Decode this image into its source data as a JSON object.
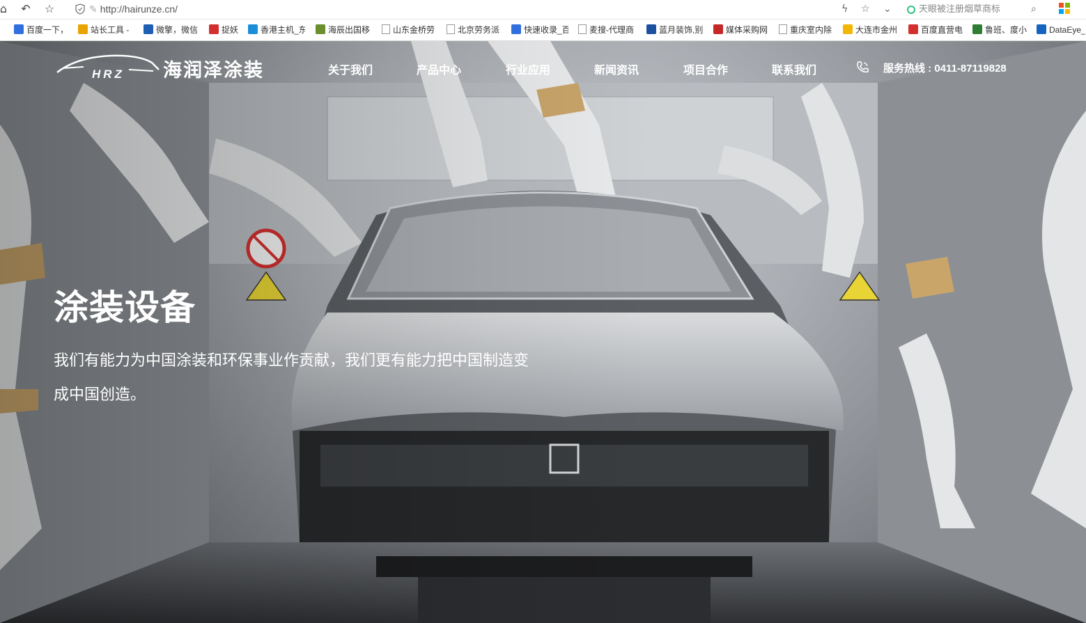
{
  "browser": {
    "url": "http://hairunze.cn/",
    "search_suggestion": "天眼被注册烟草商标",
    "bookmarks": [
      {
        "label": "百度一下，",
        "icon": "paw-icon",
        "color": "#2f6fde"
      },
      {
        "label": "站长工具 -",
        "icon": "chart-icon",
        "color": "#e8a400"
      },
      {
        "label": "微擎，微信",
        "icon": "m-icon",
        "color": "#1e5fb3"
      },
      {
        "label": "捉妖",
        "icon": "red-badge-icon",
        "color": "#d32f2f"
      },
      {
        "label": "香港主机_东",
        "icon": "ie-icon",
        "color": "#1a8fd8"
      },
      {
        "label": "海辰出国移",
        "icon": "grid-icon",
        "color": "#6a8f2d"
      },
      {
        "label": "山东金桥劳",
        "icon": "page-icon",
        "color": "#999999"
      },
      {
        "label": "北京劳务派",
        "icon": "page-icon",
        "color": "#999999"
      },
      {
        "label": "快速收录_百",
        "icon": "paw-icon",
        "color": "#2f6fde"
      },
      {
        "label": "麦搜-代理商",
        "icon": "page-icon",
        "color": "#999999"
      },
      {
        "label": "蓝月装饰,别",
        "icon": "circle-icon",
        "color": "#1b4fa0"
      },
      {
        "label": "媒体采购网",
        "icon": "m-icon",
        "color": "#c62828"
      },
      {
        "label": "重庆室内除",
        "icon": "page-icon",
        "color": "#999999"
      },
      {
        "label": "大连市金州",
        "icon": "flag-icon",
        "color": "#f2b705"
      },
      {
        "label": "百度直营电",
        "icon": "pin-icon",
        "color": "#d32f2f"
      },
      {
        "label": "鲁班、度小",
        "icon": "leaf-icon",
        "color": "#2e7d32"
      },
      {
        "label": "DataEye_",
        "icon": "shield-icon",
        "color": "#1565c0"
      }
    ]
  },
  "site": {
    "logo_mark": "HRZ",
    "logo_name": "海润泽涂装",
    "nav": [
      "关于我们",
      "产品中心",
      "行业应用",
      "新闻资讯",
      "项目合作",
      "联系我们"
    ],
    "hotline": "服务热线 : 0411-87119828"
  },
  "hero": {
    "title": "涂装设备",
    "description": "我们有能力为中国涂装和环保事业作贡献，我们更有能力把中国制造变成中国创造。"
  }
}
